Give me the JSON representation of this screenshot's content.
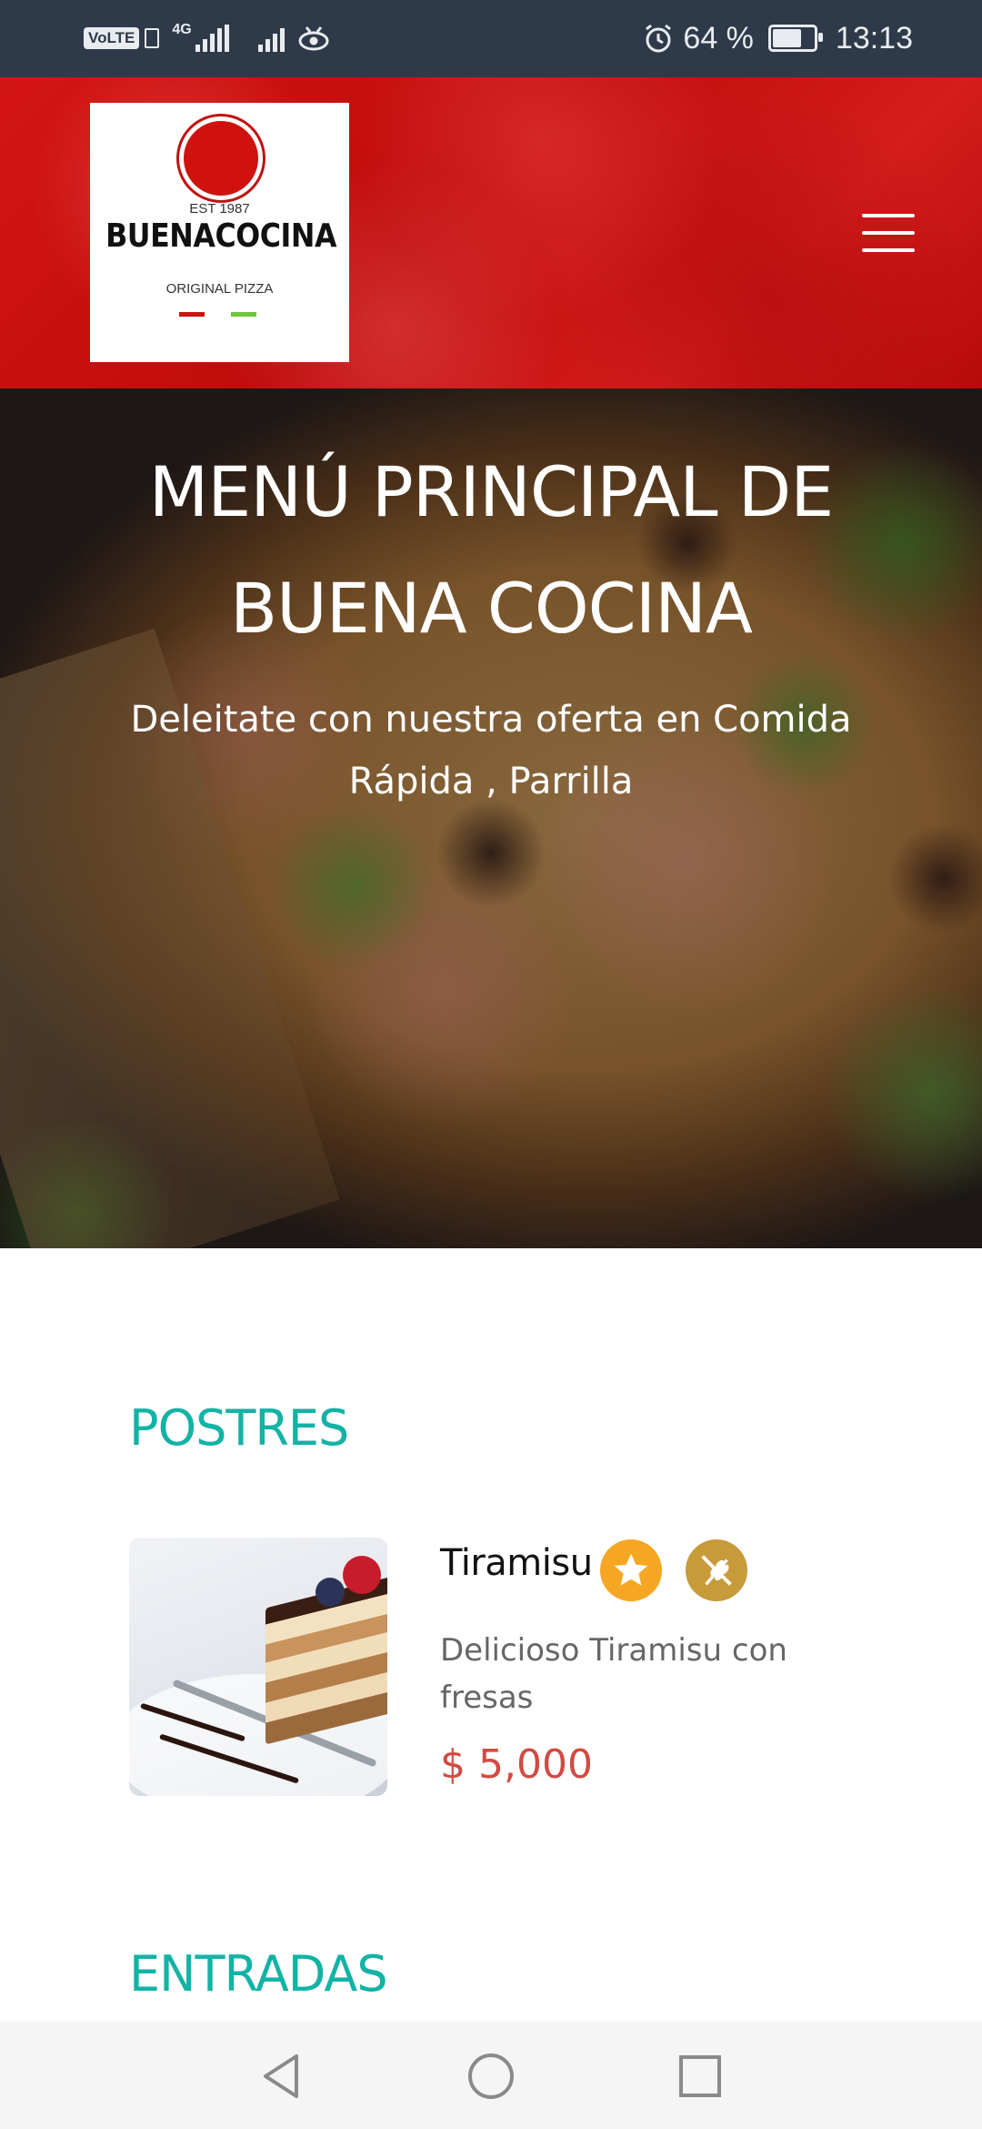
{
  "status_bar": {
    "volte": "VoLTE",
    "network": "4G",
    "battery_percent": "64 %",
    "battery_level": 0.64,
    "time": "13:13",
    "icons": [
      "volte-icon",
      "signal-icon",
      "signal-icon",
      "eye-icon",
      "alarm-icon",
      "battery-icon"
    ]
  },
  "header": {
    "logo": {
      "est": "EST 1987",
      "name": "BUENACOCINA",
      "subtitle": "ORIGINAL PIZZA",
      "colors": {
        "circle": "#d0120f",
        "dash_left": "#c8140f",
        "dash_right": "#6cc63a"
      }
    },
    "menu_icon": "hamburger-icon",
    "background_color": "#c80f0f"
  },
  "hero": {
    "title": "MENÚ PRINCIPAL DE BUENA COCINA",
    "subtitle": "Deleitate con nuestra oferta en Comida Rápida , Parrilla"
  },
  "sections": [
    {
      "title": "POSTRES",
      "items": [
        {
          "name": "Tiramisu",
          "description": "Delicioso Tiramisu con fresas",
          "price": "$ 5,000",
          "badges": [
            "star-icon",
            "gluten-free-icon"
          ]
        }
      ]
    },
    {
      "title": "ENTRADAS",
      "items": []
    }
  ],
  "colors": {
    "section_title": "#12b3a5",
    "price": "#d24a43",
    "status_bar": "#2e3a4a"
  },
  "nav_bar": {
    "icons": [
      "back-icon",
      "home-icon",
      "recents-icon"
    ]
  }
}
